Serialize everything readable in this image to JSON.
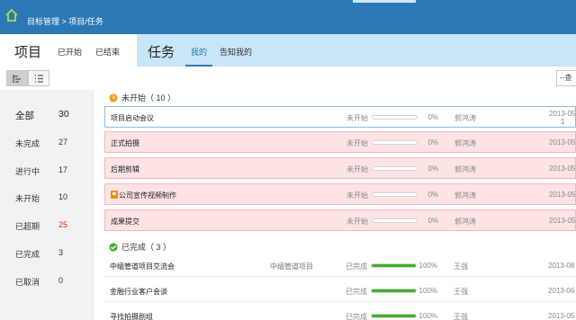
{
  "header": {
    "breadcrumb": "目标管理 > 项目/任务"
  },
  "subheader": {
    "project_title": "项目",
    "project_tabs": [
      "已开始",
      "已结束"
    ],
    "task_title": "任务",
    "task_tabs": [
      "我的",
      "告知我的"
    ],
    "active_task_tab": "我的"
  },
  "toolbar": {
    "more_label": "--查"
  },
  "stats": [
    {
      "label": "全部",
      "count": "30"
    },
    {
      "label": "未完成",
      "count": "27"
    },
    {
      "label": "进行中",
      "count": "17"
    },
    {
      "label": "未开始",
      "count": "10"
    },
    {
      "label": "已超期",
      "count": "25",
      "color": "#d9261c"
    },
    {
      "label": "已完成",
      "count": "3"
    },
    {
      "label": "已取消",
      "count": "0"
    }
  ],
  "groups": {
    "not_started": {
      "title": "未开始（ 10 ）",
      "tasks": [
        {
          "name": "项目启动会议",
          "project": "",
          "status": "未开始",
          "progress": 0,
          "pct": "0%",
          "owner": "郭鸿涛",
          "date": "2013-05",
          "date_suffix": "1",
          "selected": true
        },
        {
          "name": "正式拍摄",
          "project": "",
          "status": "未开始",
          "progress": 0,
          "pct": "0%",
          "owner": "郭鸿涛",
          "date": "2013-05"
        },
        {
          "name": "后期剪辑",
          "project": "",
          "status": "未开始",
          "progress": 0,
          "pct": "0%",
          "owner": "郭鸿涛",
          "date": "2013-05"
        },
        {
          "name": "公司宣传视频制作",
          "project": "",
          "status": "未开始",
          "progress": 0,
          "pct": "0%",
          "owner": "郭鸿涛",
          "date": "2013-05",
          "flag": true
        },
        {
          "name": "成果提交",
          "project": "",
          "status": "未开始",
          "progress": 0,
          "pct": "0%",
          "owner": "郭鸿涛",
          "date": "2013-05"
        }
      ]
    },
    "completed": {
      "title": "已完成（ 3 ）",
      "tasks": [
        {
          "name": "中缅管道项目交流会",
          "project": "中缅管道项目",
          "status": "已完成",
          "progress": 1.0,
          "pct": "100%",
          "owner": "王强",
          "date": "2013-08"
        },
        {
          "name": "金融行业客户会谈",
          "project": "",
          "status": "已完成",
          "progress": 1.0,
          "pct": "100%",
          "owner": "王强",
          "date": "2013-06"
        },
        {
          "name": "寻找拍摄剧组",
          "project": "",
          "status": "已完成",
          "progress": 1.0,
          "pct": "100%",
          "owner": "王强",
          "date": "2013-05"
        }
      ]
    }
  },
  "colors": {
    "header_blue": "#2b78b5",
    "pending_row": "#fde3e4",
    "progress_green": "#43b02a",
    "overdue_red": "#d9261c"
  }
}
